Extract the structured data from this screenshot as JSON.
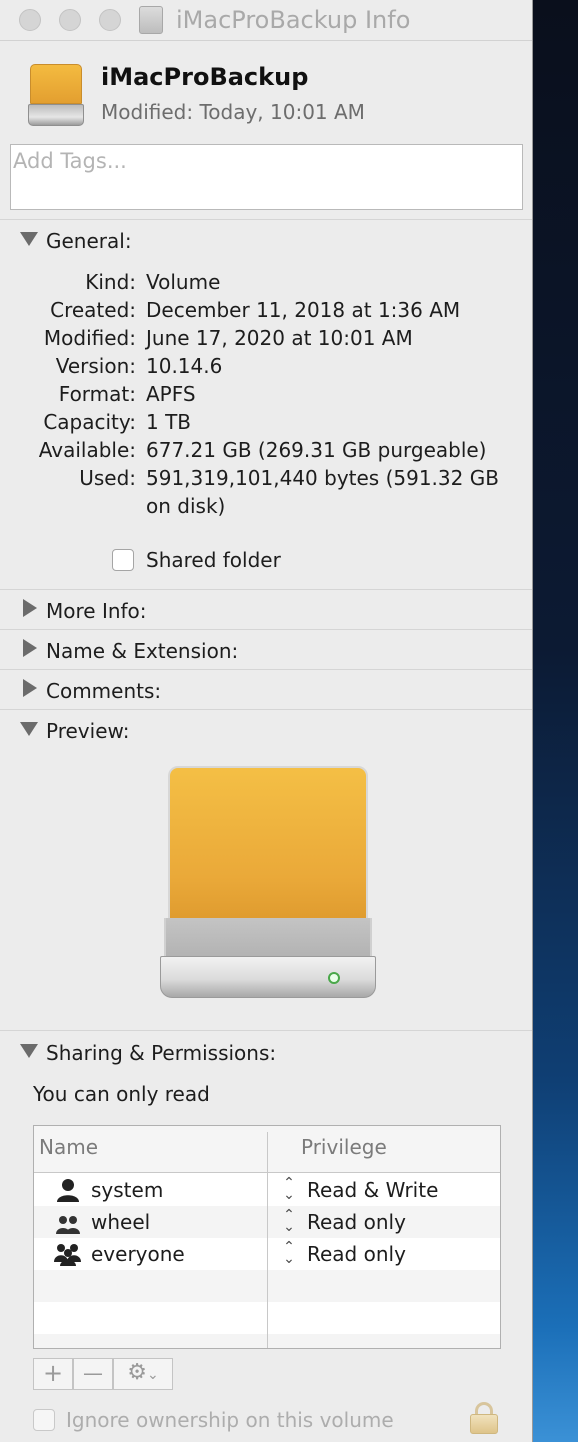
{
  "window": {
    "title": "iMacProBackup Info"
  },
  "header": {
    "volume_name": "iMacProBackup",
    "modified_label": "Modified:",
    "modified_value": "Today, 10:01 AM",
    "tags_placeholder": "Add Tags..."
  },
  "sections": {
    "general": "General:",
    "more_info": "More Info:",
    "name_extension": "Name & Extension:",
    "comments": "Comments:",
    "preview": "Preview:",
    "sharing": "Sharing & Permissions:"
  },
  "general": {
    "rows": [
      {
        "label": "Kind:",
        "value": "Volume"
      },
      {
        "label": "Created:",
        "value": "December 11, 2018 at 1:36 AM"
      },
      {
        "label": "Modified:",
        "value": "June 17, 2020 at 10:01 AM"
      },
      {
        "label": "Version:",
        "value": "10.14.6"
      },
      {
        "label": "Format:",
        "value": "APFS"
      },
      {
        "label": "Capacity:",
        "value": "1 TB"
      },
      {
        "label": "Available:",
        "value": "677.21 GB (269.31 GB purgeable)"
      },
      {
        "label": "Used:",
        "value": "591,319,101,440 bytes (591.32 GB on disk)"
      }
    ],
    "shared_folder_label": "Shared folder",
    "shared_folder_checked": false
  },
  "permissions": {
    "note": "You can only read",
    "col_name": "Name",
    "col_privilege": "Privilege",
    "rows": [
      {
        "name": "system",
        "privilege": "Read & Write",
        "icon": "single-user-icon"
      },
      {
        "name": "wheel",
        "privilege": "Read only",
        "icon": "group-icon"
      },
      {
        "name": "everyone",
        "privilege": "Read only",
        "icon": "everyone-icon"
      }
    ],
    "add_symbol": "+",
    "remove_symbol": "—",
    "action_symbol": "⚙",
    "ignore_ownership_label": "Ignore ownership on this volume"
  },
  "colors": {
    "drive_orange": "#eaa939",
    "window_bg": "#ececec"
  }
}
